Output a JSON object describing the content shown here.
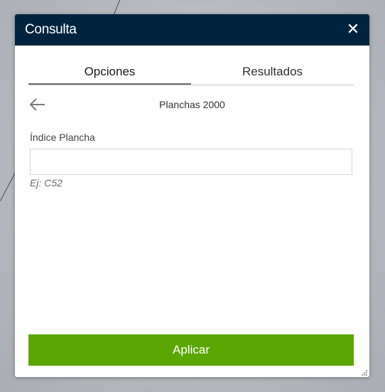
{
  "dialog": {
    "title": "Consulta",
    "close_symbol": "✕"
  },
  "tabs": [
    {
      "label": "Opciones",
      "active": true
    },
    {
      "label": "Resultados",
      "active": false
    }
  ],
  "query": {
    "back_icon": "arrow-left-icon",
    "layer_title": "Planchas 2000",
    "field_label": "Índice Plancha",
    "field_value": "",
    "hint": "Ej: C52"
  },
  "actions": {
    "apply_label": "Aplicar"
  },
  "colors": {
    "header": "#002440",
    "apply": "#5aa703",
    "backdrop": "#b8bbc0"
  }
}
